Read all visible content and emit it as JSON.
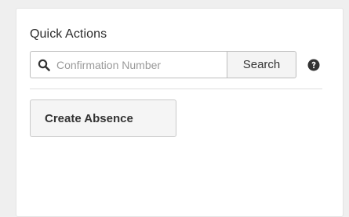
{
  "quick_actions": {
    "title": "Quick Actions",
    "search": {
      "placeholder": "Confirmation Number",
      "value": "",
      "icon": "search-icon",
      "button_label": "Search",
      "help_icon": "question-circle-icon"
    },
    "create_absence_label": "Create Absence"
  }
}
